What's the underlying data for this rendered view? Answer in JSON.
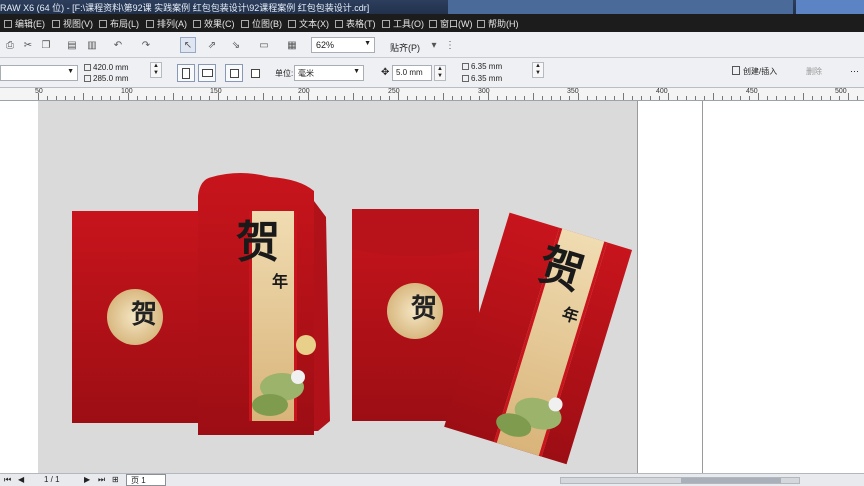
{
  "titlebar": {
    "text": "RAW X6 (64 位) - [F:\\课程资料\\第92课 实践案例 红包包装设计\\92课程案例 红包包装设计.cdr]"
  },
  "menu": [
    {
      "label": "编辑(E)"
    },
    {
      "label": "视图(V)"
    },
    {
      "label": "布局(L)"
    },
    {
      "label": "排列(A)"
    },
    {
      "label": "效果(C)"
    },
    {
      "label": "位图(B)"
    },
    {
      "label": "文本(X)"
    },
    {
      "label": "表格(T)"
    },
    {
      "label": "工具(O)"
    },
    {
      "label": "窗口(W)"
    },
    {
      "label": "帮助(H)"
    }
  ],
  "toolbar": {
    "zoom_value": "62%",
    "snap_label": "贴齐(P)"
  },
  "property_bar": {
    "page_width": "420.0 mm",
    "page_height": "285.0 mm",
    "unit_label": "单位:",
    "unit_value": "毫米",
    "nudge_value": "5.0 mm",
    "duplicate_x": "6.35 mm",
    "duplicate_y": "6.35 mm",
    "create_label": "创建/插入",
    "remove_label": "删除"
  },
  "ruler": {
    "ticks": [
      "50",
      "100",
      "150",
      "200",
      "250",
      "300",
      "350",
      "400",
      "450",
      "500"
    ]
  },
  "artwork": {
    "calligraphy": "贺",
    "small_char": "年",
    "circle_char": "贺"
  },
  "statusbar": {
    "page_info": "1 / 1",
    "page_tab": "页 1"
  },
  "colors": {
    "envelope_red": "#c8141c",
    "envelope_dark": "#9c0e14",
    "gold_band": "#e8cfa0",
    "page_bg": "#dadada"
  }
}
